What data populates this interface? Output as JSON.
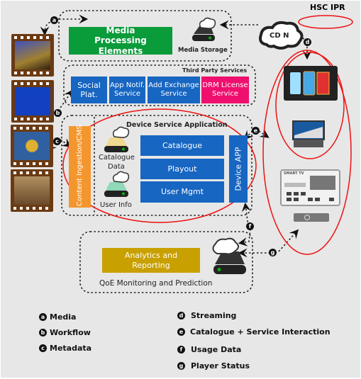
{
  "header": {
    "title": "HSC IPR"
  },
  "media": {
    "processing": "Media Processing Elements",
    "storage": "Media Storage",
    "cdn": "CD N"
  },
  "third_party": {
    "title": "Third Party Services",
    "items": [
      {
        "label": "Social Plat."
      },
      {
        "label": "App Notif. Service"
      },
      {
        "label": "Add Exchange Service"
      },
      {
        "label": "DRM License Service"
      }
    ]
  },
  "dsa": {
    "title": "Device Service Application",
    "ingestion": "Content Ingestion/CMS",
    "catalogue_data": "Catalogue Data",
    "user_info": "User Info",
    "modules": [
      {
        "label": "Catalogue"
      },
      {
        "label": "Playout"
      },
      {
        "label": "User Mgmt"
      }
    ],
    "device_app": "Device APP"
  },
  "qoe": {
    "analytics": "Analytics and Reporting",
    "title": "QoE Monitoring and Prediction"
  },
  "devices": {
    "tv_label": "SMART TV"
  },
  "markers": [
    "a",
    "b",
    "c",
    "d",
    "e",
    "f",
    "g"
  ],
  "legend": [
    {
      "key": "a",
      "label": "Media"
    },
    {
      "key": "b",
      "label": "Workflow"
    },
    {
      "key": "c",
      "label": "Metadata"
    },
    {
      "key": "d",
      "label": "Streaming"
    },
    {
      "key": "e",
      "label": "Catalogue + Service Interaction"
    },
    {
      "key": "f",
      "label": "Usage Data"
    },
    {
      "key": "g",
      "label": "Player Status"
    }
  ],
  "colors": {
    "green": "#0a9b3a",
    "blue": "#1766c2",
    "pink": "#ef0f6e",
    "orange": "#f4962e",
    "gold": "#c8a000",
    "red": "#ee1111"
  },
  "icons": [
    "film-strip-icon",
    "server-cloud-icon",
    "cloud-icon",
    "smartphone-icon",
    "laptop-icon",
    "smart-tv-icon",
    "remote-icon"
  ]
}
